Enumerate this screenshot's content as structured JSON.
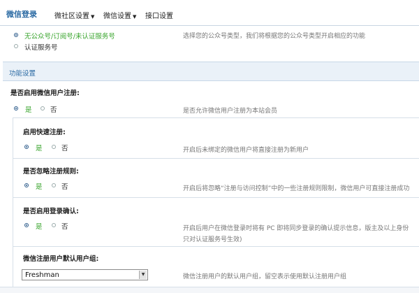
{
  "nav": {
    "brand": "微信登录",
    "tabs": [
      {
        "label": "微社区设置",
        "caret": "▼"
      },
      {
        "label": "微信设置",
        "caret": "▼"
      },
      {
        "label": "接口设置",
        "caret": ""
      }
    ]
  },
  "account_type": {
    "options": [
      {
        "label": "无公众号/订阅号/未认证服务号",
        "selected": true
      },
      {
        "label": "认证服务号",
        "selected": false
      }
    ],
    "hint": "选择您的公众号类型，我们将根据您的公众号类型开启相应的功能"
  },
  "section_title": "功能设置",
  "settings": [
    {
      "question": "是否启用微信用户注册:",
      "yes": "是",
      "no": "否",
      "value": "是",
      "hint": "是否允许微信用户注册为本站会员"
    },
    {
      "question": "启用快速注册:",
      "yes": "是",
      "no": "否",
      "value": "是",
      "hint": "开启后未绑定的微信用户将直接注册为新用户"
    },
    {
      "question": "是否忽略注册规则:",
      "yes": "是",
      "no": "否",
      "value": "是",
      "hint": "开启后将忽略“注册与访问控制”中的一些注册规则限制，微信用户可直接注册成功"
    },
    {
      "question": "是否启用登录确认:",
      "yes": "是",
      "no": "否",
      "value": "是",
      "hint": "开启后用户在微信登录时将有 PC 即将同步登录的确认提示信息，版主及以上身份",
      "hint2": "只对认证服务号生效)"
    }
  ],
  "default_group": {
    "question": "微信注册用户默认用户组:",
    "value": "Freshman",
    "hint": "微信注册用户的默认用户组，留空表示使用默认注册用户组"
  }
}
